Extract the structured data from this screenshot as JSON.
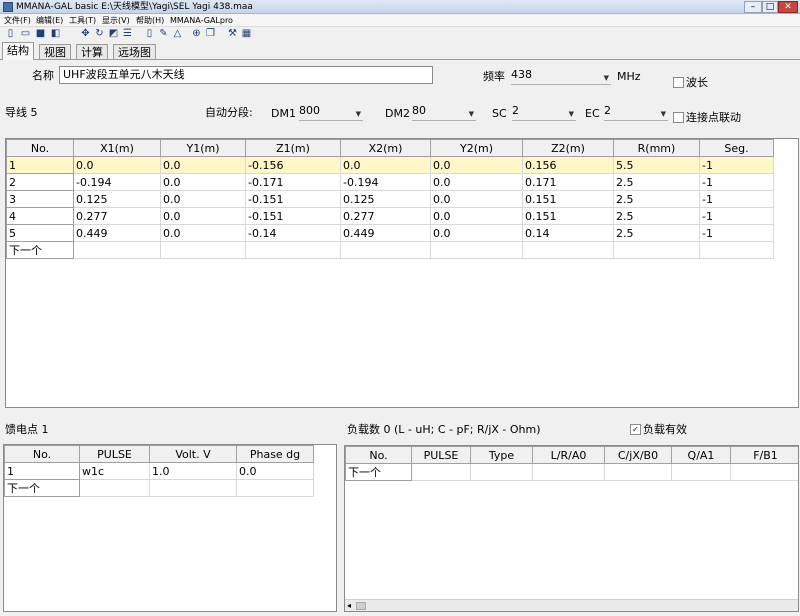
{
  "window": {
    "title": "MMANA-GAL basic E:\\天线模型\\Yagi\\SEL Yagi 438.maa",
    "min": "–",
    "max": "□",
    "close": "✕"
  },
  "menu": [
    "文件(F)",
    "编辑(E)",
    "工具(T)",
    "显示(V)",
    "帮助(H)",
    "MMANA-GALpro"
  ],
  "toolbar_icons": [
    "new-file-icon",
    "open-folder-icon",
    "save-icon",
    "save-all-icon",
    "move-icon",
    "rotate-icon",
    "edit-geometry-icon",
    "settings-sliders-icon",
    "page-icon",
    "edit-icon",
    "triangle-icon",
    "target-icon",
    "copy-icon",
    "tools-icon",
    "calculator-icon"
  ],
  "tabs": [
    "结构",
    "视图",
    "计算",
    "远场图"
  ],
  "form": {
    "name_label": "名称",
    "name_value": "UHF波段五单元八木天线",
    "freq_label": "频率",
    "freq_value": "438",
    "freq_unit": "MHz",
    "wavelength_label": "波长",
    "wires_label": "导线 5",
    "autoseg_label": "自动分段:",
    "dm1_label": "DM1",
    "dm1_value": "800",
    "dm2_label": "DM2",
    "dm2_value": "80",
    "sc_label": "SC",
    "sc_value": "2",
    "ec_label": "EC",
    "ec_value": "2",
    "link_label": "连接点联动"
  },
  "wires_table": {
    "headers": [
      "No.",
      "X1(m)",
      "Y1(m)",
      "Z1(m)",
      "X2(m)",
      "Y2(m)",
      "Z2(m)",
      "R(mm)",
      "Seg."
    ],
    "rows": [
      [
        "1",
        "0.0",
        "0.0",
        "-0.156",
        "0.0",
        "0.0",
        "0.156",
        "5.5",
        "-1"
      ],
      [
        "2",
        "-0.194",
        "0.0",
        "-0.171",
        "-0.194",
        "0.0",
        "0.171",
        "2.5",
        "-1"
      ],
      [
        "3",
        "0.125",
        "0.0",
        "-0.151",
        "0.125",
        "0.0",
        "0.151",
        "2.5",
        "-1"
      ],
      [
        "4",
        "0.277",
        "0.0",
        "-0.151",
        "0.277",
        "0.0",
        "0.151",
        "2.5",
        "-1"
      ],
      [
        "5",
        "0.449",
        "0.0",
        "-0.14",
        "0.449",
        "0.0",
        "0.14",
        "2.5",
        "-1"
      ]
    ],
    "next": "下一个"
  },
  "feed": {
    "label": "馈电点 1",
    "headers": [
      "No.",
      "PULSE",
      "Volt. V",
      "Phase dg"
    ],
    "rows": [
      [
        "1",
        "w1c",
        "1.0",
        "0.0"
      ]
    ],
    "next": "下一个"
  },
  "loads": {
    "label": "负载数 0 (L - uH; C - pF; R/jX - Ohm)",
    "enabled_label": "负载有效",
    "headers": [
      "No.",
      "PULSE",
      "Type",
      "L/R/A0",
      "C/jX/B0",
      "Q/A1",
      "F/B1"
    ],
    "next": "下一个"
  }
}
